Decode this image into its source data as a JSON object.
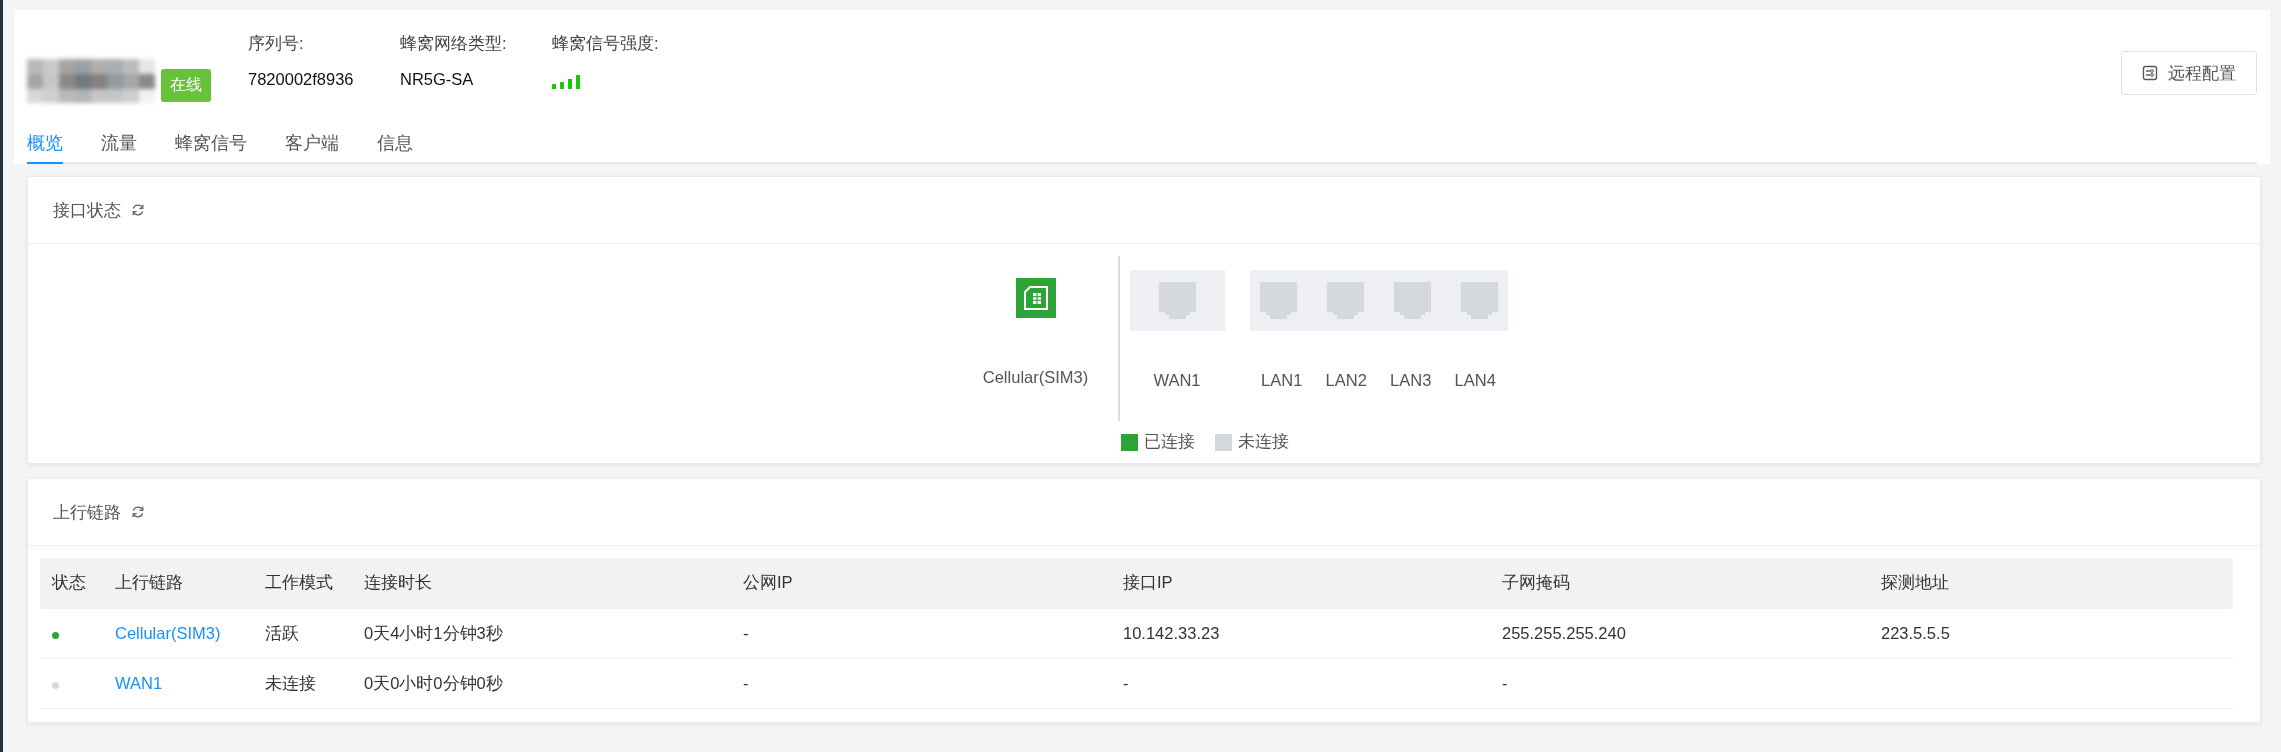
{
  "device": {
    "status": "在线",
    "online": true,
    "fields": [
      {
        "label": "序列号:",
        "value": "7820002f8936",
        "kind": "text"
      },
      {
        "label": "蜂窝网络类型:",
        "value": "NR5G-SA",
        "kind": "text"
      },
      {
        "label": "蜂窝信号强度:",
        "kind": "signal"
      }
    ]
  },
  "remote_button": "远程配置",
  "tabs": [
    {
      "label": "概览",
      "selected": true
    },
    {
      "label": "流量",
      "selected": false
    },
    {
      "label": "蜂窝信号",
      "selected": false
    },
    {
      "label": "客户端",
      "selected": false
    },
    {
      "label": "信息",
      "selected": false
    }
  ],
  "interface_status": {
    "title": "接口状态",
    "cellular": {
      "label": "Cellular(SIM3)",
      "connected": true
    },
    "port_groups": [
      {
        "ports": [
          {
            "label": "WAN1",
            "connected": false
          }
        ]
      },
      {
        "ports": [
          {
            "label": "LAN1",
            "connected": false
          },
          {
            "label": "LAN2",
            "connected": false
          },
          {
            "label": "LAN3",
            "connected": false
          },
          {
            "label": "LAN4",
            "connected": false
          }
        ]
      }
    ],
    "legend": [
      {
        "label": "已连接",
        "color": "#2ea337"
      },
      {
        "label": "未连接",
        "color": "#d5d8dd"
      }
    ]
  },
  "uplinks": {
    "title": "上行链路",
    "columns": [
      "状态",
      "上行链路",
      "工作模式",
      "连接时长",
      "公网IP",
      "接口IP",
      "子网掩码",
      "探测地址"
    ],
    "rows": [
      {
        "color": "#2ea337",
        "link": "Cellular(SIM3)",
        "mode": "活跃",
        "duration": "0天4小时1分钟3秒",
        "public_ip": "-",
        "interface_ip": "10.142.33.23",
        "netmask": "255.255.255.240",
        "probe": "223.5.5.5"
      },
      {
        "color": "#d5d8dd",
        "link": "WAN1",
        "mode": "未连接",
        "duration": "0天0小时0分钟0秒",
        "public_ip": "-",
        "interface_ip": "-",
        "netmask": "-"
      }
    ]
  }
}
